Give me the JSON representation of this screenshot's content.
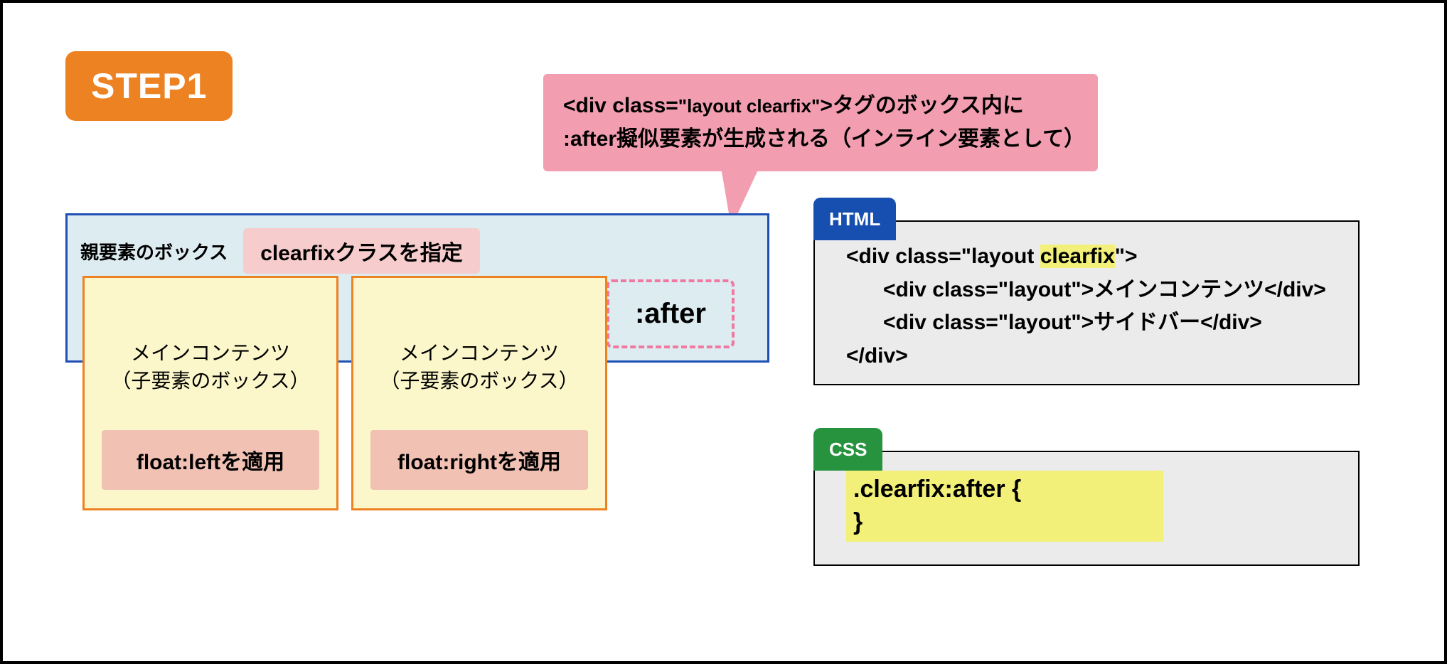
{
  "step_badge": "STEP1",
  "callout": {
    "line1_prefix": "<div class=",
    "line1_attr": "\"layout clearfix\"",
    "line1_suffix": ">タグのボックス内に",
    "line2": ":after擬似要素が生成される（インライン要素として）"
  },
  "parent_box": {
    "label": "親要素のボックス",
    "clearfix_pill": "clearfixクラスを指定",
    "after_label": ":after"
  },
  "child_left": {
    "title_line1": "メインコンテンツ",
    "title_line2": "（子要素のボックス）",
    "float_label": "float:leftを適用"
  },
  "child_right": {
    "title_line1": "メインコンテンツ",
    "title_line2": "（子要素のボックス）",
    "float_label": "float:rightを適用"
  },
  "html_panel": {
    "tag": "HTML",
    "line1_pre": "<div class=\"layout ",
    "line1_hl": "clearfix",
    "line1_post": "\">",
    "line2": "<div class=\"layout\">メインコンテンツ</div>",
    "line3": "<div class=\"layout\">サイドバー</div>",
    "line4": "</div>"
  },
  "css_panel": {
    "tag": "CSS",
    "code": ".clearfix:after {\n}"
  }
}
